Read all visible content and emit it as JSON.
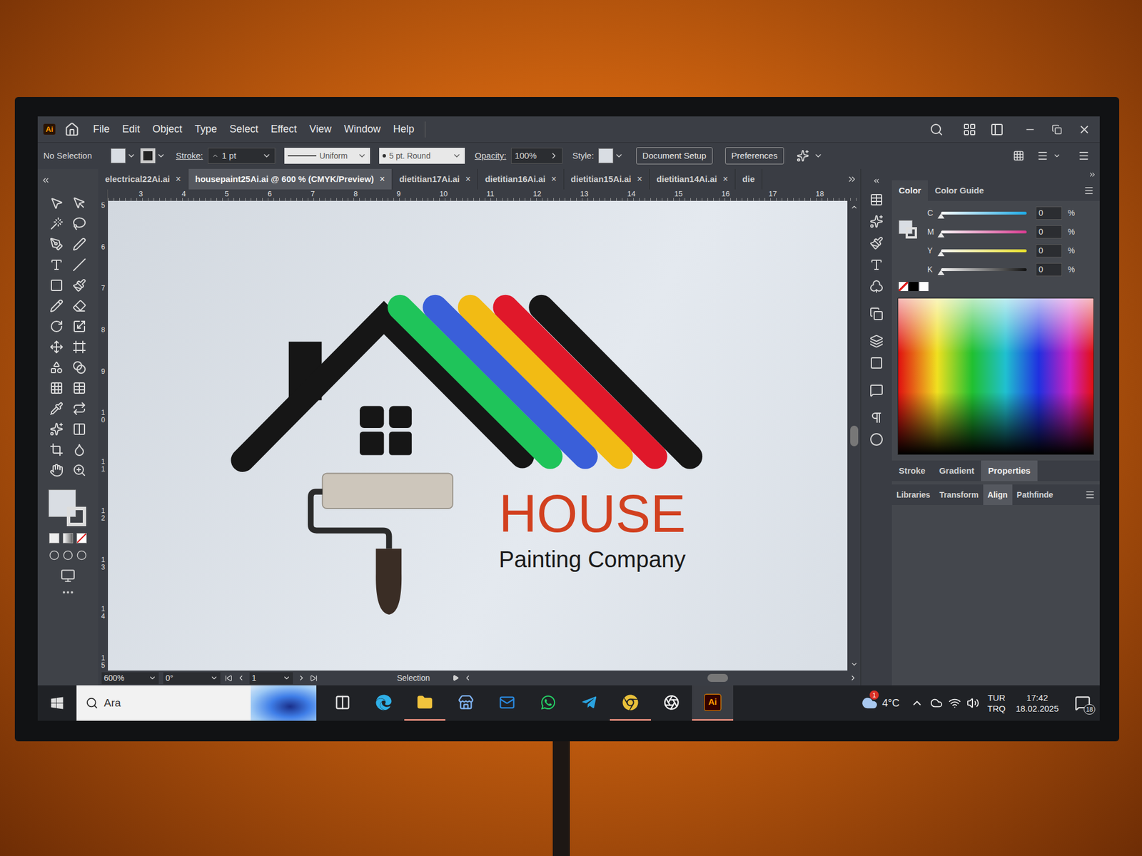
{
  "app": {
    "badge": "Ai"
  },
  "menu": [
    "File",
    "Edit",
    "Object",
    "Type",
    "Select",
    "Effect",
    "View",
    "Window",
    "Help"
  ],
  "control_bar": {
    "selection": "No Selection",
    "stroke_label": "Stroke:",
    "stroke_value": "1 pt",
    "profile": "Uniform",
    "brush": "5 pt. Round",
    "opacity_label": "Opacity:",
    "opacity_value": "100%",
    "style_label": "Style:",
    "buttons": [
      "Document Setup",
      "Preferences"
    ]
  },
  "tabs": [
    {
      "label": "electrical22Ai.ai",
      "selected": false
    },
    {
      "label": "housepaint25Ai.ai @ 600 % (CMYK/Preview)",
      "selected": true
    },
    {
      "label": "dietitian17Ai.ai",
      "selected": false
    },
    {
      "label": "dietitian16Ai.ai",
      "selected": false
    },
    {
      "label": "dietitian15Ai.ai",
      "selected": false
    },
    {
      "label": "dietitian14Ai.ai",
      "selected": false
    },
    {
      "label": "die",
      "selected": false
    }
  ],
  "tab_close": "×",
  "ruler": {
    "horizontal": [
      "3",
      "4",
      "5",
      "6",
      "7",
      "8",
      "9",
      "10",
      "11",
      "12",
      "13",
      "14",
      "15",
      "16",
      "17",
      "18"
    ],
    "vertical": [
      "5",
      "6",
      "7",
      "8",
      "9",
      "10",
      "11",
      "12",
      "13",
      "14",
      "15"
    ]
  },
  "artwork": {
    "title": "HOUSE",
    "subtitle": "Painting Company",
    "stripes": [
      {
        "color": "#1fc45a"
      },
      {
        "color": "#3a5fd9"
      },
      {
        "color": "#f2bb14"
      },
      {
        "color": "#e0182a"
      },
      {
        "color": "#161616"
      }
    ]
  },
  "color_panel": {
    "tabs": [
      {
        "label": "Color",
        "selected": true
      },
      {
        "label": "Color Guide",
        "selected": false
      }
    ],
    "channels": [
      {
        "name": "C",
        "value": "0",
        "unit": "%",
        "level": 0,
        "color": "#1ea7e1"
      },
      {
        "name": "M",
        "value": "0",
        "unit": "%",
        "level": 0,
        "color": "#d63a8f"
      },
      {
        "name": "Y",
        "value": "0",
        "unit": "%",
        "level": 0,
        "color": "#e8e02a"
      },
      {
        "name": "K",
        "value": "0",
        "unit": "%",
        "level": 0,
        "color": "#111111"
      }
    ]
  },
  "panel_tabs_1": [
    {
      "label": "Stroke",
      "selected": false
    },
    {
      "label": "Gradient",
      "selected": false
    },
    {
      "label": "Properties",
      "selected": true
    }
  ],
  "panel_tabs_2": [
    {
      "label": "Libraries",
      "selected": false
    },
    {
      "label": "Transform",
      "selected": false
    },
    {
      "label": "Align",
      "selected": true
    },
    {
      "label": "Pathfinde",
      "selected": false
    }
  ],
  "status_bar": {
    "zoom": "600%",
    "rotation": "0°",
    "artboard": "1",
    "tool": "Selection"
  },
  "taskbar": {
    "search_placeholder": "Ara",
    "apps": [
      {
        "kind": "taskview",
        "active": false,
        "label": ""
      },
      {
        "kind": "edge",
        "active": false,
        "label": ""
      },
      {
        "kind": "explorer",
        "active": true,
        "label": ""
      },
      {
        "kind": "store",
        "active": false,
        "label": ""
      },
      {
        "kind": "outlook",
        "active": false,
        "label": ""
      },
      {
        "kind": "whatsapp",
        "active": false,
        "label": ""
      },
      {
        "kind": "telegram",
        "active": false,
        "label": ""
      },
      {
        "kind": "chrome",
        "active": true,
        "label": ""
      },
      {
        "kind": "chatgpt",
        "active": false,
        "label": ""
      },
      {
        "kind": "illustrator",
        "active": true,
        "label": "Ai"
      }
    ],
    "weather": "4°C",
    "weather_badge": "1",
    "language": [
      "TUR",
      "TRQ"
    ],
    "time": "17:42",
    "date": "18.02.2025",
    "notifications": "18"
  }
}
